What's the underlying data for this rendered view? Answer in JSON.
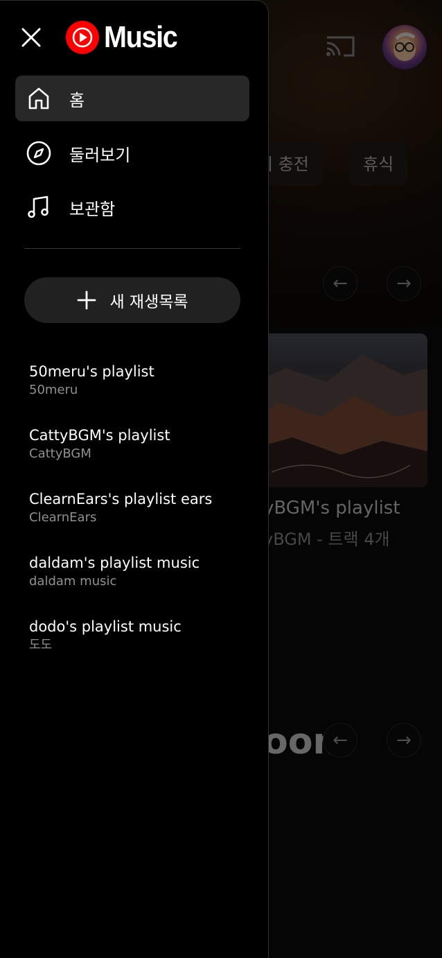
{
  "background": {
    "chips": [
      "지 충전",
      "휴식"
    ],
    "card_title": "yBGM's playlist",
    "card_subtitle": "yBGM - 트랙 4개",
    "section_heading_fragment": "oom",
    "arrows": {
      "prev": "←",
      "next": "→"
    }
  },
  "drawer": {
    "brand": "Music",
    "nav": [
      {
        "label": "홈",
        "icon": "home-icon",
        "active": true
      },
      {
        "label": "둘러보기",
        "icon": "compass-icon",
        "active": false
      },
      {
        "label": "보관함",
        "icon": "music-note-icon",
        "active": false
      }
    ],
    "new_playlist_label": "새 재생목록",
    "playlists": [
      {
        "title": "50meru's playlist",
        "owner": "50meru"
      },
      {
        "title": "CattyBGM's playlist",
        "owner": "CattyBGM"
      },
      {
        "title": "ClearnEars's playlist ears",
        "owner": "ClearnEars"
      },
      {
        "title": "daldam's playlist music",
        "owner": "daldam music"
      },
      {
        "title": "dodo's playlist music",
        "owner": "도도"
      }
    ]
  },
  "colors": {
    "logo_red": "#ff0000",
    "active_item_bg": "#282828",
    "button_bg": "#212121",
    "secondary_text": "#909090"
  }
}
